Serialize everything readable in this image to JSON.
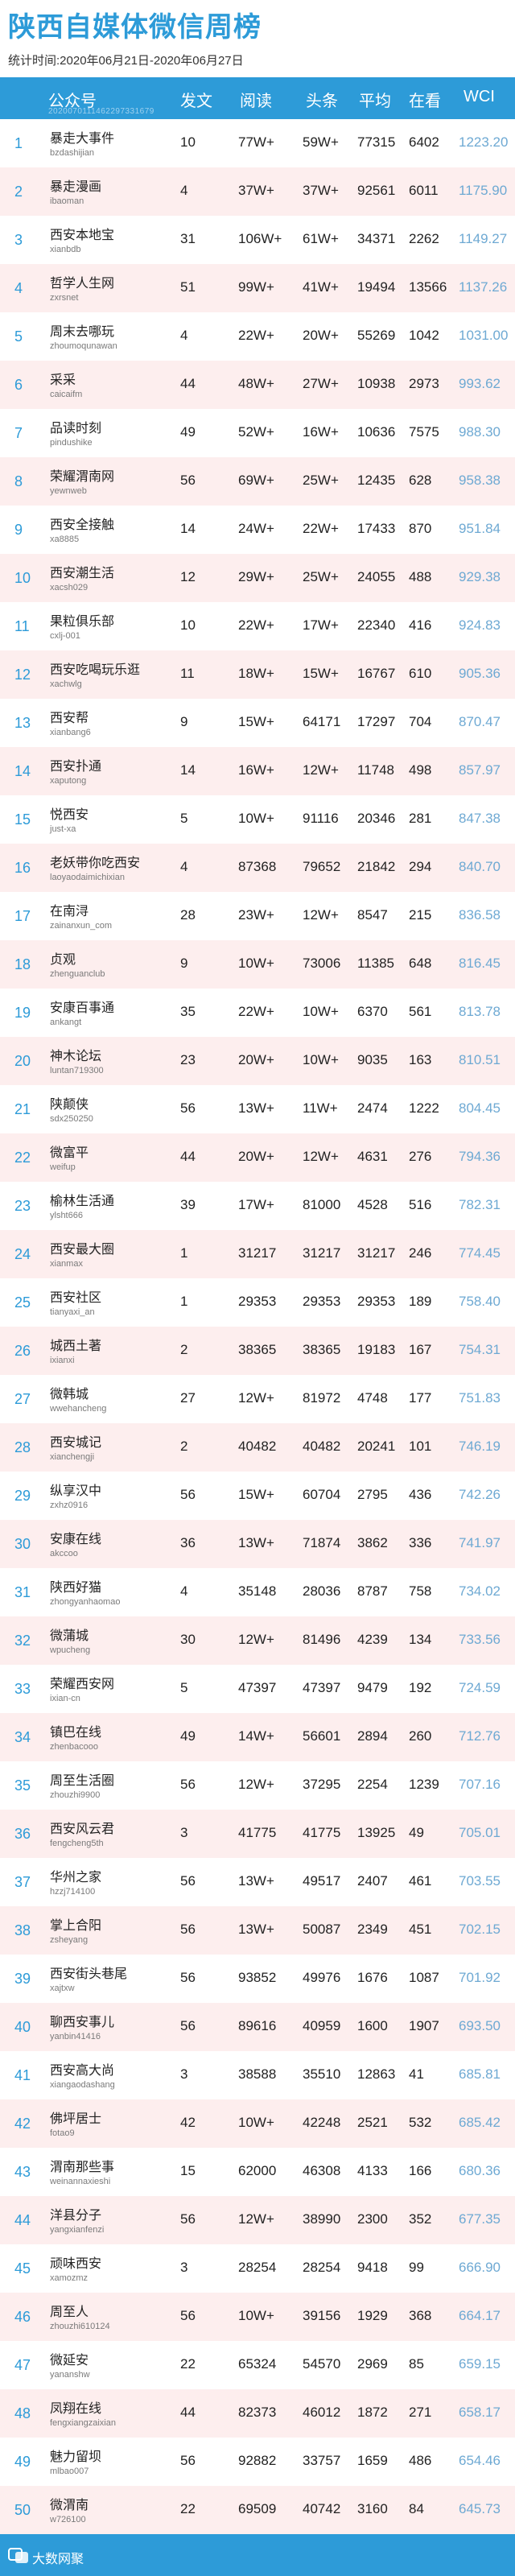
{
  "title": "陕西自媒体微信周榜",
  "subtitle": "统计时间:2020年06月21日-2020年06月27日",
  "columns": {
    "rank": "",
    "account": "公众号",
    "posts": "发文",
    "reads": "阅读",
    "headline": "头条",
    "average": "平均",
    "likes": "在看",
    "wci": "WCI"
  },
  "table_id": "2020070111462297331679",
  "rows": [
    {
      "rank": "1",
      "name": "暴走大事件",
      "account": "bzdashijian",
      "posts": "10",
      "reads": "77W+",
      "headline": "59W+",
      "average": "77315",
      "likes": "6402",
      "wci": "1223.20"
    },
    {
      "rank": "2",
      "name": "暴走漫画",
      "account": "ibaoman",
      "posts": "4",
      "reads": "37W+",
      "headline": "37W+",
      "average": "92561",
      "likes": "6011",
      "wci": "1175.90"
    },
    {
      "rank": "3",
      "name": "西安本地宝",
      "account": "xianbdb",
      "posts": "31",
      "reads": "106W+",
      "headline": "61W+",
      "average": "34371",
      "likes": "2262",
      "wci": "1149.27"
    },
    {
      "rank": "4",
      "name": "哲学人生网",
      "account": "zxrsnet",
      "posts": "51",
      "reads": "99W+",
      "headline": "41W+",
      "average": "19494",
      "likes": "13566",
      "wci": "1137.26"
    },
    {
      "rank": "5",
      "name": "周末去哪玩",
      "account": "zhoumoqunawan",
      "posts": "4",
      "reads": "22W+",
      "headline": "20W+",
      "average": "55269",
      "likes": "1042",
      "wci": "1031.00"
    },
    {
      "rank": "6",
      "name": "采采",
      "account": "caicaifm",
      "posts": "44",
      "reads": "48W+",
      "headline": "27W+",
      "average": "10938",
      "likes": "2973",
      "wci": "993.62"
    },
    {
      "rank": "7",
      "name": "品读时刻",
      "account": "pindushike",
      "posts": "49",
      "reads": "52W+",
      "headline": "16W+",
      "average": "10636",
      "likes": "7575",
      "wci": "988.30"
    },
    {
      "rank": "8",
      "name": "荣耀渭南网",
      "account": "yewnweb",
      "posts": "56",
      "reads": "69W+",
      "headline": "25W+",
      "average": "12435",
      "likes": "628",
      "wci": "958.38"
    },
    {
      "rank": "9",
      "name": "西安全接触",
      "account": "xa8885",
      "posts": "14",
      "reads": "24W+",
      "headline": "22W+",
      "average": "17433",
      "likes": "870",
      "wci": "951.84"
    },
    {
      "rank": "10",
      "name": "西安潮生活",
      "account": "xacsh029",
      "posts": "12",
      "reads": "29W+",
      "headline": "25W+",
      "average": "24055",
      "likes": "488",
      "wci": "929.38"
    },
    {
      "rank": "11",
      "name": "果粒俱乐部",
      "account": "cxlj-001",
      "posts": "10",
      "reads": "22W+",
      "headline": "17W+",
      "average": "22340",
      "likes": "416",
      "wci": "924.83"
    },
    {
      "rank": "12",
      "name": "西安吃喝玩乐逛",
      "account": "xachwlg",
      "posts": "11",
      "reads": "18W+",
      "headline": "15W+",
      "average": "16767",
      "likes": "610",
      "wci": "905.36"
    },
    {
      "rank": "13",
      "name": "西安帮",
      "account": "xianbang6",
      "posts": "9",
      "reads": "15W+",
      "headline": "64171",
      "average": "17297",
      "likes": "704",
      "wci": "870.47"
    },
    {
      "rank": "14",
      "name": "西安扑通",
      "account": "xaputong",
      "posts": "14",
      "reads": "16W+",
      "headline": "12W+",
      "average": "11748",
      "likes": "498",
      "wci": "857.97"
    },
    {
      "rank": "15",
      "name": "悦西安",
      "account": "just-xa",
      "posts": "5",
      "reads": "10W+",
      "headline": "91116",
      "average": "20346",
      "likes": "281",
      "wci": "847.38"
    },
    {
      "rank": "16",
      "name": "老妖带你吃西安",
      "account": "laoyaodaimichixian",
      "posts": "4",
      "reads": "87368",
      "headline": "79652",
      "average": "21842",
      "likes": "294",
      "wci": "840.70"
    },
    {
      "rank": "17",
      "name": "在南浔",
      "account": "zainanxun_com",
      "posts": "28",
      "reads": "23W+",
      "headline": "12W+",
      "average": "8547",
      "likes": "215",
      "wci": "836.58"
    },
    {
      "rank": "18",
      "name": "贞观",
      "account": "zhenguanclub",
      "posts": "9",
      "reads": "10W+",
      "headline": "73006",
      "average": "11385",
      "likes": "648",
      "wci": "816.45"
    },
    {
      "rank": "19",
      "name": "安康百事通",
      "account": "ankangt",
      "posts": "35",
      "reads": "22W+",
      "headline": "10W+",
      "average": "6370",
      "likes": "561",
      "wci": "813.78"
    },
    {
      "rank": "20",
      "name": "神木论坛",
      "account": "luntan719300",
      "posts": "23",
      "reads": "20W+",
      "headline": "10W+",
      "average": "9035",
      "likes": "163",
      "wci": "810.51"
    },
    {
      "rank": "21",
      "name": "陕颠侠",
      "account": "sdx250250",
      "posts": "56",
      "reads": "13W+",
      "headline": "11W+",
      "average": "2474",
      "likes": "1222",
      "wci": "804.45"
    },
    {
      "rank": "22",
      "name": "微富平",
      "account": "weifup",
      "posts": "44",
      "reads": "20W+",
      "headline": "12W+",
      "average": "4631",
      "likes": "276",
      "wci": "794.36"
    },
    {
      "rank": "23",
      "name": "榆林生活通",
      "account": "ylsht666",
      "posts": "39",
      "reads": "17W+",
      "headline": "81000",
      "average": "4528",
      "likes": "516",
      "wci": "782.31"
    },
    {
      "rank": "24",
      "name": "西安最大圈",
      "account": "xianmax",
      "posts": "1",
      "reads": "31217",
      "headline": "31217",
      "average": "31217",
      "likes": "246",
      "wci": "774.45"
    },
    {
      "rank": "25",
      "name": "西安社区",
      "account": "tianyaxi_an",
      "posts": "1",
      "reads": "29353",
      "headline": "29353",
      "average": "29353",
      "likes": "189",
      "wci": "758.40"
    },
    {
      "rank": "26",
      "name": "城西土著",
      "account": "ixianxi",
      "posts": "2",
      "reads": "38365",
      "headline": "38365",
      "average": "19183",
      "likes": "167",
      "wci": "754.31"
    },
    {
      "rank": "27",
      "name": "微韩城",
      "account": "wwehancheng",
      "posts": "27",
      "reads": "12W+",
      "headline": "81972",
      "average": "4748",
      "likes": "177",
      "wci": "751.83"
    },
    {
      "rank": "28",
      "name": "西安城记",
      "account": "xianchengji",
      "posts": "2",
      "reads": "40482",
      "headline": "40482",
      "average": "20241",
      "likes": "101",
      "wci": "746.19"
    },
    {
      "rank": "29",
      "name": "纵享汉中",
      "account": "zxhz0916",
      "posts": "56",
      "reads": "15W+",
      "headline": "60704",
      "average": "2795",
      "likes": "436",
      "wci": "742.26"
    },
    {
      "rank": "30",
      "name": "安康在线",
      "account": "akccoo",
      "posts": "36",
      "reads": "13W+",
      "headline": "71874",
      "average": "3862",
      "likes": "336",
      "wci": "741.97"
    },
    {
      "rank": "31",
      "name": "陕西好猫",
      "account": "zhongyanhaomao",
      "posts": "4",
      "reads": "35148",
      "headline": "28036",
      "average": "8787",
      "likes": "758",
      "wci": "734.02"
    },
    {
      "rank": "32",
      "name": "微蒲城",
      "account": "wpucheng",
      "posts": "30",
      "reads": "12W+",
      "headline": "81496",
      "average": "4239",
      "likes": "134",
      "wci": "733.56"
    },
    {
      "rank": "33",
      "name": "荣耀西安网",
      "account": "ixian-cn",
      "posts": "5",
      "reads": "47397",
      "headline": "47397",
      "average": "9479",
      "likes": "192",
      "wci": "724.59"
    },
    {
      "rank": "34",
      "name": "镇巴在线",
      "account": "zhenbacooo",
      "posts": "49",
      "reads": "14W+",
      "headline": "56601",
      "average": "2894",
      "likes": "260",
      "wci": "712.76"
    },
    {
      "rank": "35",
      "name": "周至生活圈",
      "account": "zhouzhi9900",
      "posts": "56",
      "reads": "12W+",
      "headline": "37295",
      "average": "2254",
      "likes": "1239",
      "wci": "707.16"
    },
    {
      "rank": "36",
      "name": "西安风云君",
      "account": "fengcheng5th",
      "posts": "3",
      "reads": "41775",
      "headline": "41775",
      "average": "13925",
      "likes": "49",
      "wci": "705.01"
    },
    {
      "rank": "37",
      "name": "华州之家",
      "account": "hzzj714100",
      "posts": "56",
      "reads": "13W+",
      "headline": "49517",
      "average": "2407",
      "likes": "461",
      "wci": "703.55"
    },
    {
      "rank": "38",
      "name": "掌上合阳",
      "account": "zsheyang",
      "posts": "56",
      "reads": "13W+",
      "headline": "50087",
      "average": "2349",
      "likes": "451",
      "wci": "702.15"
    },
    {
      "rank": "39",
      "name": "西安街头巷尾",
      "account": "xajtxw",
      "posts": "56",
      "reads": "93852",
      "headline": "49976",
      "average": "1676",
      "likes": "1087",
      "wci": "701.92"
    },
    {
      "rank": "40",
      "name": "聊西安事儿",
      "account": "yanbin41416",
      "posts": "56",
      "reads": "89616",
      "headline": "40959",
      "average": "1600",
      "likes": "1907",
      "wci": "693.50"
    },
    {
      "rank": "41",
      "name": "西安高大尚",
      "account": "xiangaodashang",
      "posts": "3",
      "reads": "38588",
      "headline": "35510",
      "average": "12863",
      "likes": "41",
      "wci": "685.81"
    },
    {
      "rank": "42",
      "name": "佛坪居士",
      "account": "fotao9",
      "posts": "42",
      "reads": "10W+",
      "headline": "42248",
      "average": "2521",
      "likes": "532",
      "wci": "685.42"
    },
    {
      "rank": "43",
      "name": "渭南那些事",
      "account": "weinannaxieshi",
      "posts": "15",
      "reads": "62000",
      "headline": "46308",
      "average": "4133",
      "likes": "166",
      "wci": "680.36"
    },
    {
      "rank": "44",
      "name": "洋县分子",
      "account": "yangxianfenzi",
      "posts": "56",
      "reads": "12W+",
      "headline": "38990",
      "average": "2300",
      "likes": "352",
      "wci": "677.35"
    },
    {
      "rank": "45",
      "name": "顽味西安",
      "account": "xamozmz",
      "posts": "3",
      "reads": "28254",
      "headline": "28254",
      "average": "9418",
      "likes": "99",
      "wci": "666.90"
    },
    {
      "rank": "46",
      "name": "周至人",
      "account": "zhouzhi610124",
      "posts": "56",
      "reads": "10W+",
      "headline": "39156",
      "average": "1929",
      "likes": "368",
      "wci": "664.17"
    },
    {
      "rank": "47",
      "name": "微延安",
      "account": "yananshw",
      "posts": "22",
      "reads": "65324",
      "headline": "54570",
      "average": "2969",
      "likes": "85",
      "wci": "659.15"
    },
    {
      "rank": "48",
      "name": "凤翔在线",
      "account": "fengxiangzaixian",
      "posts": "44",
      "reads": "82373",
      "headline": "46012",
      "average": "1872",
      "likes": "271",
      "wci": "658.17"
    },
    {
      "rank": "49",
      "name": "魅力留坝",
      "account": "mlbao007",
      "posts": "56",
      "reads": "92882",
      "headline": "33757",
      "average": "1659",
      "likes": "486",
      "wci": "654.46"
    },
    {
      "rank": "50",
      "name": "微渭南",
      "account": "w726100",
      "posts": "22",
      "reads": "69509",
      "headline": "40742",
      "average": "3160",
      "likes": "84",
      "wci": "645.73"
    }
  ],
  "footer": {
    "brand": "大数网聚"
  },
  "colors": {
    "accent": "#2d9bd8",
    "row_alt": "#fdeeee",
    "wci_text": "#6ea9d3"
  }
}
